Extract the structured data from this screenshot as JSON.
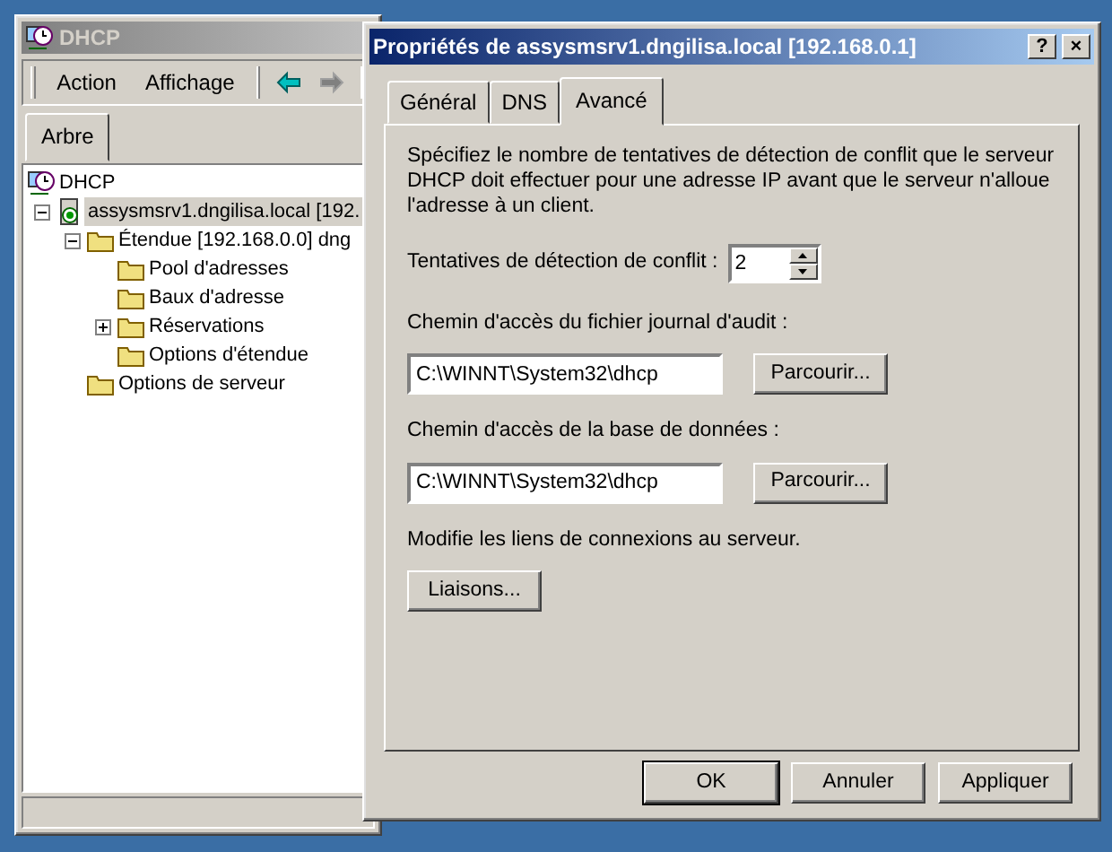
{
  "console": {
    "title": "DHCP",
    "menu": [
      {
        "label": "Action"
      },
      {
        "label": "Affichage"
      }
    ],
    "nav": [
      {
        "disabled": false
      },
      {
        "disabled": true
      }
    ],
    "tabs": [
      {
        "label": "Arbre",
        "selected": true
      }
    ],
    "tree": [
      {
        "label": "DHCP",
        "selected": false,
        "children": [
          {
            "label": "assysmsrv1.dngilisa.local [192.",
            "selected": true,
            "expanded": true,
            "children": [
              {
                "label": "Étendue [192.168.0.0] dng",
                "selected": false,
                "expanded": true,
                "children": [
                  {
                    "label": "Pool d'adresses",
                    "selected": false
                  },
                  {
                    "label": "Baux d'adresse",
                    "selected": false
                  },
                  {
                    "label": "Réservations",
                    "selected": false,
                    "expanded": false
                  },
                  {
                    "label": "Options d'étendue",
                    "selected": false
                  }
                ]
              },
              {
                "label": "Options de serveur",
                "selected": false
              }
            ]
          }
        ]
      }
    ]
  },
  "dialog": {
    "title": "Propriétés de assysmsrv1.dngilisa.local [192.168.0.1]",
    "title_buttons": [
      "?",
      "×"
    ],
    "tabs": [
      {
        "label": "Général",
        "selected": false
      },
      {
        "label": "DNS",
        "selected": false
      },
      {
        "label": "Avancé",
        "selected": true
      }
    ],
    "description": "Spécifiez le nombre de tentatives de détection de conflit que le serveur DHCP doit effectuer pour une adresse IP avant que le serveur n'alloue l'adresse à un client.",
    "conflict": {
      "label": "Tentatives de détection de conflit :",
      "value": "2"
    },
    "paths": [
      {
        "label": "Chemin d'accès du fichier journal d'audit :",
        "value": "C:\\WINNT\\System32\\dhcp",
        "button": "Parcourir..."
      },
      {
        "label": "Chemin d'accès de la base de données :",
        "value": "C:\\WINNT\\System32\\dhcp",
        "button": "Parcourir..."
      }
    ],
    "bindings": {
      "text": "Modifie les liens de connexions au serveur.",
      "button": "Liaisons..."
    },
    "buttons": [
      {
        "label": "OK",
        "default": true
      },
      {
        "label": "Annuler",
        "default": false
      },
      {
        "label": "Appliquer",
        "default": false
      }
    ]
  }
}
